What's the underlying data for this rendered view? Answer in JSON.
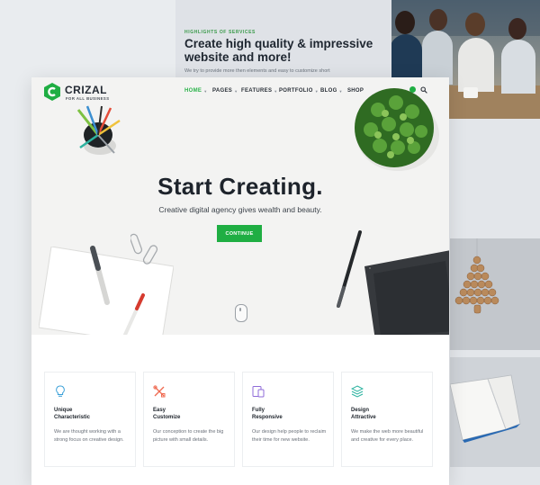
{
  "banner": {
    "eyebrow": "HIGHLIGHTS OF SERVICES",
    "headline": "Create high quality & impressive website and more!",
    "description": "We try to provide more then elements and easy to customize short"
  },
  "brand": {
    "name": "CRIZAL",
    "tagline": "FOR ALL BUSINESS",
    "logo_letter": "C",
    "accent": "#2bb34b"
  },
  "nav": {
    "items": [
      {
        "label": "HOME",
        "active": true
      },
      {
        "label": "PAGES",
        "active": false
      },
      {
        "label": "FEATURES",
        "active": false
      },
      {
        "label": "PORTFOLIO",
        "active": false
      },
      {
        "label": "BLOG",
        "active": false
      },
      {
        "label": "SHOP",
        "active": false
      }
    ],
    "icons": [
      "search-icon"
    ]
  },
  "hero": {
    "title": "Start Creating.",
    "subtitle": "Creative digital agency gives wealth and beauty.",
    "button": "CONTINUE"
  },
  "features": [
    {
      "title": "Unique\nCharacteristic",
      "description": "We are thought working with a strong focus on creative design.",
      "icon": "lightbulb-icon",
      "color": "#3aa0d8"
    },
    {
      "title": "Easy\nCustomize",
      "description": "Our conception to create the big picture with small details.",
      "icon": "tools-icon",
      "color": "#ef6b52"
    },
    {
      "title": "Fully\nResponsive",
      "description": "Our design help people to reclaim their time for new website.",
      "icon": "devices-icon",
      "color": "#8f6bd8"
    },
    {
      "title": "Design\nAttractive",
      "description": "We make the web more beautiful and creative for every place.",
      "icon": "layers-icon",
      "color": "#2bb3a0"
    }
  ]
}
